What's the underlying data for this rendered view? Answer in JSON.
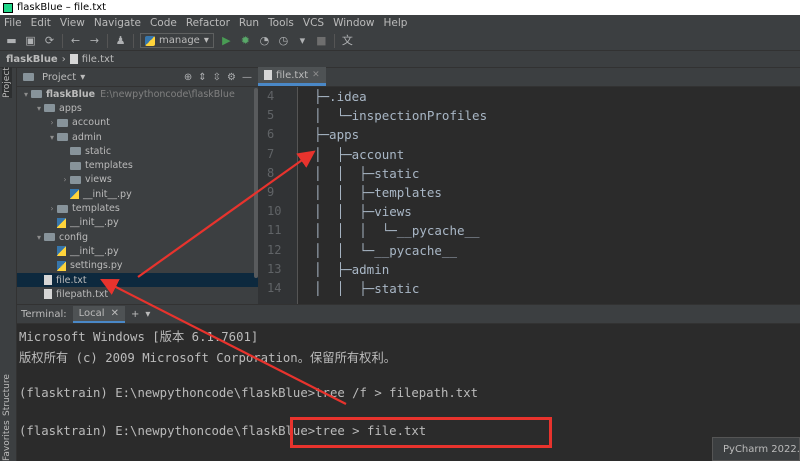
{
  "window": {
    "title": "flaskBlue – file.txt"
  },
  "menu": [
    "File",
    "Edit",
    "View",
    "Navigate",
    "Code",
    "Refactor",
    "Run",
    "Tools",
    "VCS",
    "Window",
    "Help"
  ],
  "toolbar": {
    "run_config": "manage"
  },
  "breadcrumb": {
    "project": "flaskBlue",
    "file": "file.txt"
  },
  "left_strip": {
    "project_label": "Project",
    "structure_label": "Structure",
    "favorites_label": "Favorites"
  },
  "project_panel": {
    "title": "Project",
    "tree": [
      {
        "label": "flaskBlue",
        "path": "E:\\newpythoncode\\flaskBlue",
        "indent": 0,
        "type": "folder",
        "state": "open"
      },
      {
        "label": "apps",
        "indent": 1,
        "type": "folder",
        "state": "open"
      },
      {
        "label": "account",
        "indent": 2,
        "type": "folder",
        "state": "closed"
      },
      {
        "label": "admin",
        "indent": 2,
        "type": "folder",
        "state": "open"
      },
      {
        "label": "static",
        "indent": 3,
        "type": "folder",
        "state": "none"
      },
      {
        "label": "templates",
        "indent": 3,
        "type": "folder",
        "state": "none"
      },
      {
        "label": "views",
        "indent": 3,
        "type": "folder",
        "state": "closed"
      },
      {
        "label": "__init__.py",
        "indent": 3,
        "type": "py",
        "state": "none"
      },
      {
        "label": "templates",
        "indent": 2,
        "type": "folder",
        "state": "closed"
      },
      {
        "label": "__init__.py",
        "indent": 2,
        "type": "py",
        "state": "none"
      },
      {
        "label": "config",
        "indent": 1,
        "type": "folder",
        "state": "open"
      },
      {
        "label": "__init__.py",
        "indent": 2,
        "type": "py",
        "state": "none"
      },
      {
        "label": "settings.py",
        "indent": 2,
        "type": "py",
        "state": "none"
      },
      {
        "label": "file.txt",
        "indent": 1,
        "type": "txt",
        "state": "none",
        "selected": true
      },
      {
        "label": "filepath.txt",
        "indent": 1,
        "type": "txt",
        "state": "none"
      }
    ]
  },
  "editor": {
    "tab": "file.txt",
    "line_numbers": [
      "4",
      "5",
      "6",
      "7",
      "8",
      "9",
      "10",
      "11",
      "12",
      "13",
      "14"
    ],
    "lines": [
      "├─.idea",
      "│  └─inspectionProfiles",
      "├─apps",
      "│  ├─account",
      "│  │  ├─static",
      "│  │  ├─templates",
      "│  │  ├─views",
      "│  │  │  └─__pycache__",
      "│  │  └─__pycache__",
      "│  ├─admin",
      "│  │  ├─static"
    ]
  },
  "terminal": {
    "label": "Terminal:",
    "tab": "Local",
    "lines": [
      "Microsoft Windows [版本 6.1.7601]",
      "版权所有 (c) 2009 Microsoft Corporation。保留所有权利。",
      "",
      "(flasktrain) E:\\newpythoncode\\flaskBlue>tree /f > filepath.txt",
      "",
      "(flasktrain) E:\\newpythoncode\\flaskBlue>tree > file.txt"
    ]
  },
  "notification": {
    "text": "PyCharm 2022."
  },
  "colors": {
    "annotation": "#e8332d",
    "accent": "#4a88c7"
  }
}
